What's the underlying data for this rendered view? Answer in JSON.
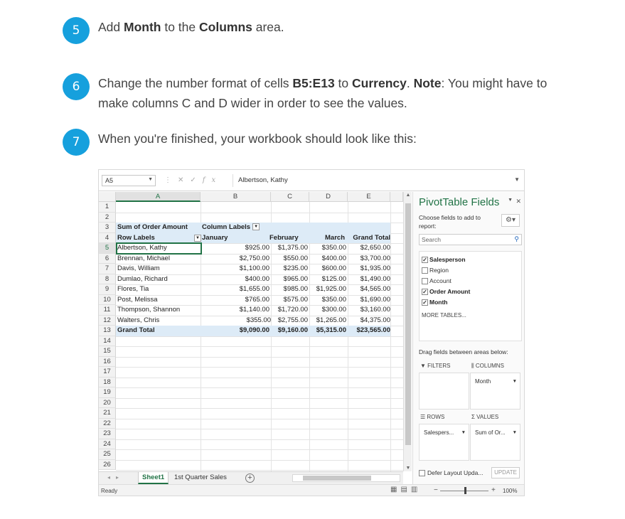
{
  "steps": [
    {
      "num": "5",
      "parts": [
        {
          "t": "Add "
        },
        {
          "t": "Month",
          "b": true
        },
        {
          "t": " to the "
        },
        {
          "t": "Columns",
          "b": true
        },
        {
          "t": " area."
        }
      ]
    },
    {
      "num": "6",
      "parts": [
        {
          "t": "Change the number format of cells "
        },
        {
          "t": "B5:E13",
          "b": true
        },
        {
          "t": " to "
        },
        {
          "t": "Currency",
          "b": true
        },
        {
          "t": ". "
        },
        {
          "t": "Note",
          "b": true
        },
        {
          "t": ": You might have to make columns C and D wider in order to see the values."
        }
      ]
    },
    {
      "num": "7",
      "parts": [
        {
          "t": "When you're finished, your workbook should look like this:"
        }
      ]
    }
  ],
  "excel": {
    "name_box": "A5",
    "formula_value": "Albertson, Kathy",
    "columns": [
      "A",
      "B",
      "C",
      "D",
      "E"
    ],
    "row_numbers": [
      "1",
      "2",
      "3",
      "4",
      "5",
      "6",
      "7",
      "8",
      "9",
      "10",
      "11",
      "12",
      "13",
      "14",
      "15",
      "16",
      "17",
      "18",
      "19",
      "20",
      "21",
      "22",
      "23",
      "24",
      "25",
      "26"
    ],
    "pivot": {
      "corner_label": "Sum of Order Amount",
      "column_labels": "Column Labels",
      "row_labels": "Row Labels",
      "months": [
        "January",
        "February",
        "March"
      ],
      "grand_total_header": "Grand Total",
      "rows": [
        {
          "name": "Albertson, Kathy",
          "jan": "$925.00",
          "feb": "$1,375.00",
          "mar": "$350.00",
          "total": "$2,650.00"
        },
        {
          "name": "Brennan, Michael",
          "jan": "$2,750.00",
          "feb": "$550.00",
          "mar": "$400.00",
          "total": "$3,700.00"
        },
        {
          "name": "Davis, William",
          "jan": "$1,100.00",
          "feb": "$235.00",
          "mar": "$600.00",
          "total": "$1,935.00"
        },
        {
          "name": "Dumlao, Richard",
          "jan": "$400.00",
          "feb": "$965.00",
          "mar": "$125.00",
          "total": "$1,490.00"
        },
        {
          "name": "Flores, Tia",
          "jan": "$1,655.00",
          "feb": "$985.00",
          "mar": "$1,925.00",
          "total": "$4,565.00"
        },
        {
          "name": "Post, Melissa",
          "jan": "$765.00",
          "feb": "$575.00",
          "mar": "$350.00",
          "total": "$1,690.00"
        },
        {
          "name": "Thompson, Shannon",
          "jan": "$1,140.00",
          "feb": "$1,720.00",
          "mar": "$300.00",
          "total": "$3,160.00"
        },
        {
          "name": "Walters, Chris",
          "jan": "",
          "feb": "$355.00",
          "mar": "$2,755.00",
          "total": "$1,265.00",
          "extra": "$4,375.00"
        }
      ],
      "grand_total": {
        "name": "Grand Total",
        "jan": "$9,090.00",
        "feb": "$9,160.00",
        "mar": "$5,315.00",
        "total": "$23,565.00"
      }
    },
    "sheets": {
      "active": "Sheet1",
      "other": "1st Quarter Sales",
      "add": "+"
    },
    "status": {
      "ready": "Ready",
      "zoom": "100%"
    }
  },
  "pivot_pane": {
    "title": "PivotTable Fields",
    "choose": "Choose fields to add to report:",
    "search_placeholder": "Search",
    "fields": [
      {
        "label": "Salesperson",
        "checked": true
      },
      {
        "label": "Region",
        "checked": false
      },
      {
        "label": "Account",
        "checked": false
      },
      {
        "label": "Order Amount",
        "checked": true
      },
      {
        "label": "Month",
        "checked": true
      }
    ],
    "more_tables": "MORE TABLES...",
    "drag_label": "Drag fields between areas below:",
    "areas": {
      "filters": "FILTERS",
      "columns": "COLUMNS",
      "rows": "ROWS",
      "values": "VALUES",
      "columns_item": "Month",
      "rows_item": "Salespers...",
      "values_item": "Sum of Or..."
    },
    "defer": "Defer Layout Upda...",
    "update": "UPDATE"
  },
  "colors": {
    "accent": "#16a0dd",
    "excel_green": "#217346",
    "pivot_band": "#ddebf7"
  }
}
